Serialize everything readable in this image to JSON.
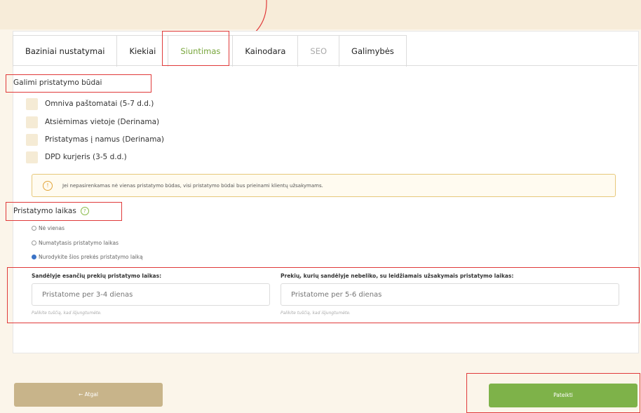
{
  "tabs": [
    {
      "label": "Baziniai nustatymai",
      "state": "normal"
    },
    {
      "label": "Kiekiai",
      "state": "normal"
    },
    {
      "label": "Siuntimas",
      "state": "active"
    },
    {
      "label": "Kainodara",
      "state": "normal"
    },
    {
      "label": "SEO",
      "state": "disabled"
    },
    {
      "label": "Galimybės",
      "state": "normal"
    }
  ],
  "delivery_methods": {
    "title": "Galimi pristatymo būdai",
    "options": [
      {
        "label": "Omniva paštomatai (5-7 d.d.)",
        "checked": false
      },
      {
        "label": "Atsiėmimas vietoje (Derinama)",
        "checked": false
      },
      {
        "label": "Pristatymas į namus (Derinama)",
        "checked": false
      },
      {
        "label": "DPD kurjeris (3-5 d.d.)",
        "checked": false
      }
    ],
    "notice_icon": "info-icon",
    "notice": "Jei nepasirenkamas nė vienas pristatymo būdas, visi pristatymo būdai bus prieinami klientų užsakymams."
  },
  "delivery_time": {
    "title": "Pristatymo laikas",
    "help_icon": "help-icon",
    "options": [
      {
        "label": "Nė vienas",
        "selected": false
      },
      {
        "label": "Numatytasis pristatymo laikas",
        "selected": false
      },
      {
        "label": "Nurodykite šios prekės pristatymo laiką",
        "selected": true
      }
    ],
    "in_stock": {
      "label": "Sandėlyje esančių prekių pristatymo laikas:",
      "placeholder": "Pristatome per 3-4 dienas",
      "hint": "Palikite tuščią, kad išjungtumėte."
    },
    "out_of_stock": {
      "label": "Prekių, kurių sandėlyje nebeliko, su leidžiamais užsakymais pristatymo laikas:",
      "placeholder": "Pristatome per 5-6 dienas",
      "hint": "Palikite tuščią, kad išjungtumėte."
    }
  },
  "buttons": {
    "back": "← Atgal",
    "submit": "Pateikti"
  },
  "colors": {
    "accent_green": "#7eb249",
    "back_button": "#c8b48a",
    "highlight_red": "#e03a3a"
  }
}
